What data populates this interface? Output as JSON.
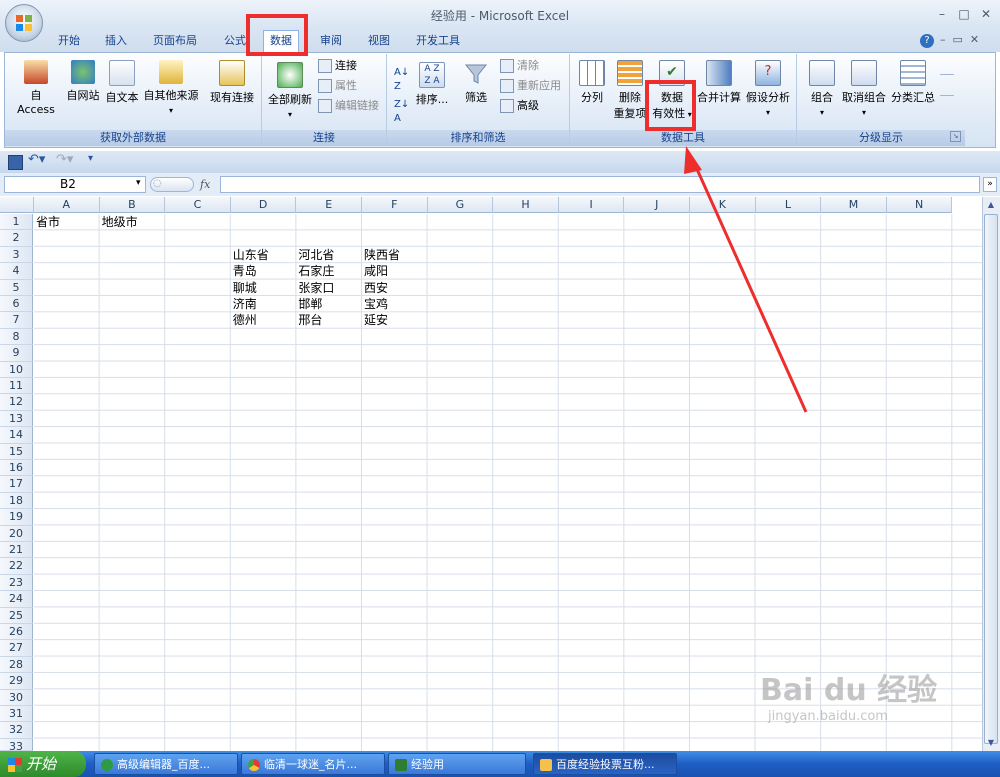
{
  "window": {
    "title": "经验用 - Microsoft Excel"
  },
  "tabs": [
    {
      "label": "开始"
    },
    {
      "label": "插入"
    },
    {
      "label": "页面布局"
    },
    {
      "label": "公式"
    },
    {
      "label": "数据",
      "active": true
    },
    {
      "label": "审阅"
    },
    {
      "label": "视图"
    },
    {
      "label": "开发工具"
    }
  ],
  "ribbon": {
    "get_external": {
      "label": "获取外部数据",
      "access": "自 Access",
      "web": "自网站",
      "text": "自文本",
      "other": "自其他来源",
      "existing": "现有连接"
    },
    "connections": {
      "label": "连接",
      "refresh_all": "全部刷新",
      "connections": "连接",
      "properties": "属性",
      "edit_links": "编辑链接"
    },
    "sort_filter": {
      "label": "排序和筛选",
      "sort": "排序...",
      "filter": "筛选",
      "clear": "清除",
      "reapply": "重新应用",
      "advanced": "高级"
    },
    "data_tools": {
      "label": "数据工具",
      "text_to_columns": "分列",
      "remove_dup_1": "删除",
      "remove_dup_2": "重复项",
      "validation_1": "数据",
      "validation_2": "有效性",
      "consolidate": "合并计算",
      "whatif": "假设分析"
    },
    "outline": {
      "label": "分级显示",
      "group": "组合",
      "ungroup": "取消组合",
      "subtotal": "分类汇总"
    }
  },
  "formula_bar": {
    "name_box": "B2",
    "fx": "fx",
    "value": ""
  },
  "columns": [
    "A",
    "B",
    "C",
    "D",
    "E",
    "F",
    "G",
    "H",
    "I",
    "J",
    "K",
    "L",
    "M",
    "N"
  ],
  "rows": [
    "1",
    "2",
    "3",
    "4",
    "5",
    "6",
    "7",
    "8",
    "9",
    "10",
    "11",
    "12",
    "13",
    "14",
    "15",
    "16",
    "17",
    "18",
    "19",
    "20",
    "21",
    "22",
    "23",
    "24",
    "25",
    "26",
    "27",
    "28",
    "29",
    "30",
    "31",
    "32",
    "33"
  ],
  "cells": {
    "A1": "省市",
    "B1": "地级市",
    "D3": "山东省",
    "E3": "河北省",
    "F3": "陕西省",
    "D4": "青岛",
    "E4": "石家庄",
    "F4": "咸阳",
    "D5": "聊城",
    "E5": "张家口",
    "F5": "西安",
    "D6": "济南",
    "E6": "邯郸",
    "F6": "宝鸡",
    "D7": "德州",
    "E7": "邢台",
    "F7": "延安"
  },
  "taskbar": {
    "start": "开始",
    "items": [
      {
        "label": "高级编辑器_百度..."
      },
      {
        "label": "临清一球迷_名片..."
      },
      {
        "label": "经验用"
      },
      {
        "label": "百度经验投票互粉..."
      }
    ]
  },
  "watermark": {
    "logo": "Bai du 经验",
    "url": "jingyan.baidu.com"
  },
  "colors": {
    "accent": "#ee2d2d",
    "ribbon": "#dbe7f5"
  }
}
